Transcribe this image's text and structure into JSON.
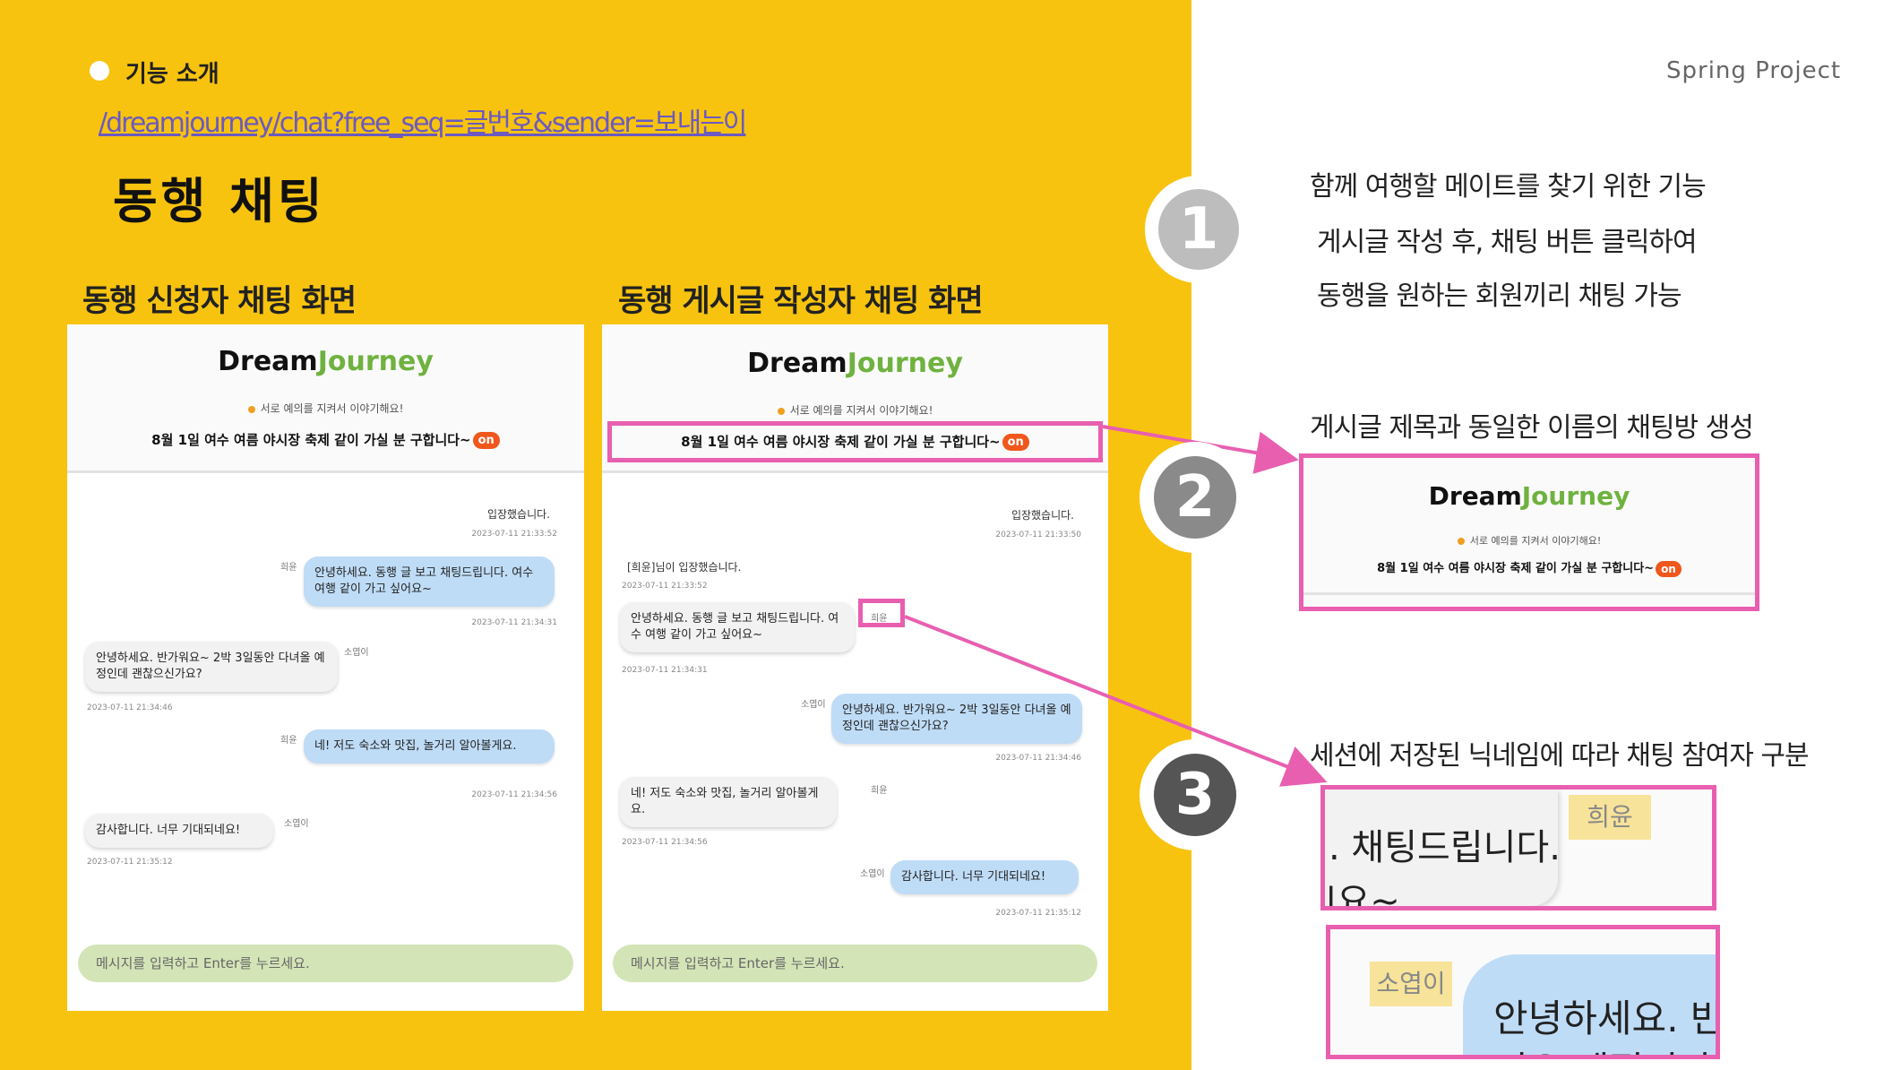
{
  "header": {
    "section_label": "기능 소개",
    "url": "/dreamjourney/chat?free_seq=글번호&sender=보내는이",
    "title": "동행 채팅",
    "project": "Spring Project"
  },
  "left_screen": {
    "caption": "동행 신청자 채팅 화면",
    "brand_dream": "Dream",
    "brand_journey": "Journey",
    "notice": "서로 예의를 지켜서 이야기해요!",
    "room_title": "8월 1일 여수 여름 야시장 축제 같이 가실 분 구합니다~",
    "on_badge": "on",
    "messages": [
      {
        "text": "입장했습니다.",
        "time": "2023-07-11 21:33:52"
      },
      {
        "nick": "희윤",
        "text": "안녕하세요. 동행 글 보고 채팅드립니다. 여수 여행 같이 가고 싶어요~",
        "time": "2023-07-11 21:34:31"
      },
      {
        "nick": "소엽이",
        "text": "안녕하세요. 반가워요~ 2박 3일동안 다녀올 예정인데 괜찮으신가요?",
        "time": "2023-07-11 21:34:46"
      },
      {
        "nick": "희윤",
        "text": "네! 저도 숙소와 맛집, 놀거리 알아볼게요.",
        "time": "2023-07-11 21:34:56"
      },
      {
        "nick": "소엽이",
        "text": "감사합니다. 너무 기대되네요!",
        "time": "2023-07-11 21:35:12"
      }
    ],
    "input_placeholder": "메시지를 입력하고 Enter를 누르세요."
  },
  "right_screen": {
    "caption": "동행 게시글 작성자 채팅 화면",
    "brand_dream": "Dream",
    "brand_journey": "Journey",
    "notice": "서로 예의를 지켜서 이야기해요!",
    "room_title": "8월 1일 여수 여름 야시장 축제 같이 가실 분 구합니다~",
    "on_badge": "on",
    "messages": [
      {
        "text": "입장했습니다.",
        "time": "2023-07-11 21:33:50"
      },
      {
        "text": "[희윤]님이 입장했습니다.",
        "time": "2023-07-11 21:33:52"
      },
      {
        "nick": "희윤",
        "text": "안녕하세요. 동행 글 보고 채팅드립니다. 여수 여행 같이 가고 싶어요~",
        "time": "2023-07-11 21:34:31"
      },
      {
        "nick": "소엽이",
        "text": "안녕하세요. 반가워요~ 2박 3일동안 다녀올 예정인데 괜찮으신가요?",
        "time": "2023-07-11 21:34:46"
      },
      {
        "nick": "희윤",
        "text": "네! 저도 숙소와 맛집, 놀거리 알아볼게요.",
        "time": "2023-07-11 21:34:56"
      },
      {
        "nick": "소엽이",
        "text": "감사합니다. 너무 기대되네요!",
        "time": "2023-07-11 21:35:12"
      }
    ],
    "input_placeholder": "메시지를 입력하고 Enter를 누르세요."
  },
  "steps": [
    {
      "number": "1",
      "lines": [
        "함께 여행할 메이트를 찾기 위한 기능",
        "게시글 작성 후, 채팅 버튼 클릭하여",
        "동행을 원하는 회원끼리 채팅 가능"
      ]
    },
    {
      "number": "2",
      "lines": [
        "게시글 제목과 동일한 이름의 채팅방 생성"
      ]
    },
    {
      "number": "3",
      "lines": [
        "세션에 저장된 닉네임에 따라 채팅 참여자 구분"
      ]
    }
  ],
  "zoom2": {
    "brand_dream": "Dream",
    "brand_journey": "Journey",
    "notice": "서로 예의를 지켜서 이야기해요!",
    "room_title": "8월 1일 여수 여름 야시장 축제 같이 가실 분 구합니다~",
    "on_badge": "on"
  },
  "zoom3a": {
    "text_line1": ". 채팅드립니다.",
    "text_line2": "|요~",
    "nick": "희윤"
  },
  "zoom3b": {
    "nick": "소엽이",
    "text_line1": "안녕하세요. 반",
    "text_line2": "녀오 예정이다"
  },
  "colors": {
    "background_left": "#f7c30f",
    "highlight": "#e85fb0",
    "brand_green": "#6fb23f",
    "on_badge": "#f0571c",
    "my_bubble": "#bfdcf7",
    "input_bar": "#d3e5b7"
  }
}
